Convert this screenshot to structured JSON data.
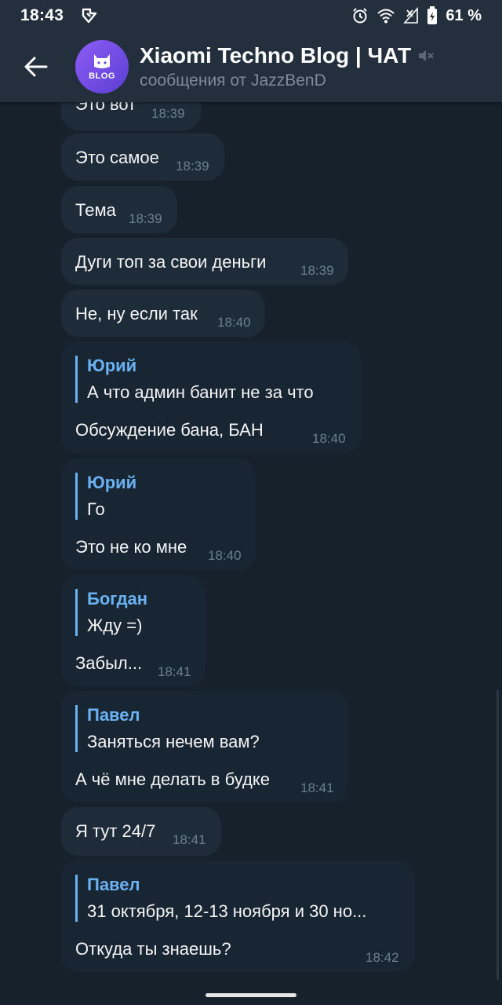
{
  "status": {
    "time": "18:43",
    "battery": "61 %"
  },
  "header": {
    "title": "Xiaomi Techno Blog | ЧАТ",
    "subtitle": "сообщения от JazzBenD",
    "avatar_text": "BLOG"
  },
  "messages": [
    {
      "text": "Это вот",
      "time": "18:39"
    },
    {
      "text": "Это самое",
      "time": "18:39"
    },
    {
      "text": "Тема",
      "time": "18:39"
    },
    {
      "text": "Дуги топ за свои деньги",
      "time": "18:39"
    },
    {
      "text": "Не, ну если так",
      "time": "18:40"
    },
    {
      "reply_author": "Юрий",
      "reply_text": "А что админ банит не за что",
      "text": "Обсуждение бана, БАН",
      "time": "18:40"
    },
    {
      "reply_author": "Юрий",
      "reply_text": "Го",
      "text": "Это не ко мне",
      "time": "18:40"
    },
    {
      "reply_author": "Богдан",
      "reply_text": "Жду =)",
      "text": "Забыл...",
      "time": "18:41"
    },
    {
      "reply_author": "Павел",
      "reply_text": "Заняться нечем вам?",
      "text": "А чё мне делать в будке",
      "time": "18:41"
    },
    {
      "text": "Я тут 24/7",
      "time": "18:41"
    },
    {
      "reply_author": "Павел",
      "reply_text": "31 октября, 12-13 ноября и 30 но...",
      "text": "Откуда ты знаешь?",
      "time": "18:42"
    }
  ]
}
